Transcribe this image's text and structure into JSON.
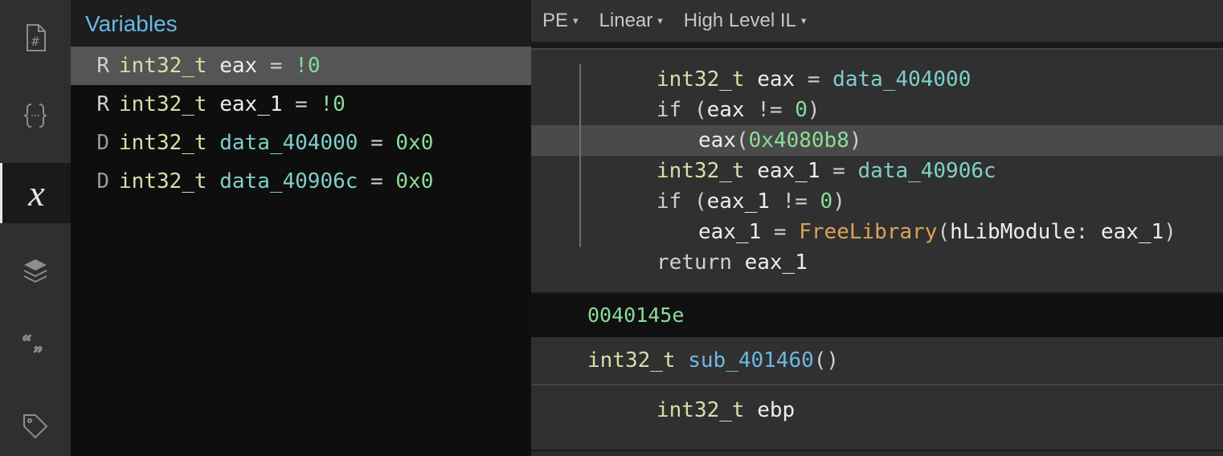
{
  "rail": {
    "icons": [
      "file-hash-icon",
      "braces-icon",
      "italic-x-icon",
      "layers-icon",
      "quotes-icon",
      "tag-icon"
    ],
    "activeIndex": 2
  },
  "varsPanel": {
    "title": "Variables",
    "rows": [
      {
        "prefix": "R",
        "type": "int32_t",
        "name": "eax",
        "nameClass": "idW",
        "eq": " = ",
        "val": "!0",
        "selected": true
      },
      {
        "prefix": "R",
        "type": "int32_t",
        "name": "eax_1",
        "nameClass": "idW",
        "eq": " = ",
        "val": "!0",
        "selected": false
      },
      {
        "prefix": "D",
        "type": "int32_t",
        "name": "data_404000",
        "nameClass": "idC",
        "eq": " = ",
        "val": "0x0",
        "selected": false
      },
      {
        "prefix": "D",
        "type": "int32_t",
        "name": "data_40906c",
        "nameClass": "idC",
        "eq": " = ",
        "val": "0x0",
        "selected": false
      }
    ]
  },
  "toolbar": {
    "items": [
      "PE",
      "Linear",
      "High Level IL"
    ]
  },
  "code": {
    "lines": [
      {
        "gut": "line",
        "hl": false,
        "segs": [
          {
            "t": "int32_t ",
            "c": "typ"
          },
          {
            "t": "eax",
            "c": "idW"
          },
          {
            "t": " = ",
            "c": "op"
          },
          {
            "t": "data_404000",
            "c": "idC"
          }
        ]
      },
      {
        "gut": "line",
        "hl": false,
        "segs": [
          {
            "t": "if ",
            "c": "kw"
          },
          {
            "t": "(",
            "c": "op"
          },
          {
            "t": "eax",
            "c": "idW"
          },
          {
            "t": " != ",
            "c": "op"
          },
          {
            "t": "0",
            "c": "numG"
          },
          {
            "t": ")",
            "c": "op"
          }
        ]
      },
      {
        "gut": "line",
        "hl": true,
        "indent": 1,
        "segs": [
          {
            "t": "eax",
            "c": "idW"
          },
          {
            "t": "(",
            "c": "op"
          },
          {
            "t": "0x4080b8",
            "c": "numG"
          },
          {
            "t": ")",
            "c": "op"
          }
        ]
      },
      {
        "gut": "line",
        "hl": false,
        "segs": [
          {
            "t": "int32_t ",
            "c": "typ"
          },
          {
            "t": "eax_1",
            "c": "idW"
          },
          {
            "t": " = ",
            "c": "op"
          },
          {
            "t": "data_40906c",
            "c": "idC"
          }
        ]
      },
      {
        "gut": "line",
        "hl": false,
        "segs": [
          {
            "t": "if ",
            "c": "kw"
          },
          {
            "t": "(",
            "c": "op"
          },
          {
            "t": "eax_1",
            "c": "idW"
          },
          {
            "t": " != ",
            "c": "op"
          },
          {
            "t": "0",
            "c": "numG"
          },
          {
            "t": ")",
            "c": "op"
          }
        ]
      },
      {
        "gut": "line",
        "hl": false,
        "indent": 1,
        "segs": [
          {
            "t": "eax_1",
            "c": "idW"
          },
          {
            "t": " = ",
            "c": "op"
          },
          {
            "t": "FreeLibrary",
            "c": "call"
          },
          {
            "t": "(",
            "c": "op"
          },
          {
            "t": "hLibModule",
            "c": "idW"
          },
          {
            "t": ": ",
            "c": "op"
          },
          {
            "t": "eax_1",
            "c": "idW"
          },
          {
            "t": ")",
            "c": "op"
          }
        ]
      },
      {
        "gut": "lineBot",
        "hl": false,
        "segs": [
          {
            "t": "return ",
            "c": "kw"
          },
          {
            "t": "eax_1",
            "c": "idW"
          }
        ]
      }
    ],
    "addr": "0040145e",
    "sig": {
      "type": "int32_t",
      "name": "sub_401460",
      "parens": "()"
    },
    "tail": {
      "segs": [
        {
          "t": "int32_t ",
          "c": "typ"
        },
        {
          "t": "ebp",
          "c": "idW"
        }
      ]
    }
  }
}
